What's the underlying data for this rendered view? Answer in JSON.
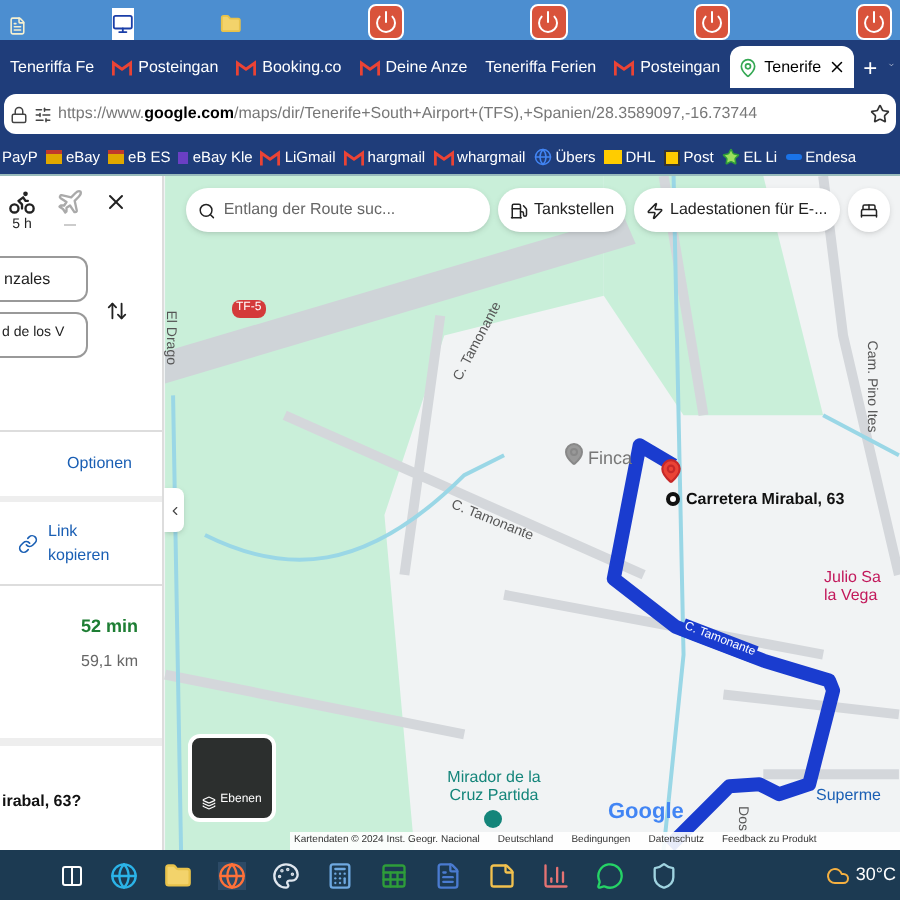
{
  "tabs": [
    {
      "label": "Teneriffa Fe",
      "kind": "plain",
      "selected": false
    },
    {
      "label": "Posteingan",
      "kind": "gmail",
      "selected": false
    },
    {
      "label": "Booking.co",
      "kind": "gmail",
      "selected": false
    },
    {
      "label": "Deine Anze",
      "kind": "gmail",
      "selected": false
    },
    {
      "label": "Teneriffa Ferien",
      "kind": "plain",
      "selected": false
    },
    {
      "label": "Posteingan",
      "kind": "gmail",
      "selected": false
    },
    {
      "label": "Tenerife",
      "kind": "maps",
      "selected": true
    }
  ],
  "new_tab": "+",
  "address_bar": {
    "url": "https://www.**google.com**/maps/dir/Tenerife+South+Airport+(TFS),+Spanien/28.3589097,-16.73744"
  },
  "bookmarks": [
    {
      "label": "PayP",
      "kind": "plain"
    },
    {
      "label": "eBay",
      "kind": "shop"
    },
    {
      "label": "eB ES",
      "kind": "shop"
    },
    {
      "label": "eBay Kle",
      "kind": "ebay"
    },
    {
      "label": "LiGmail",
      "kind": "gmail"
    },
    {
      "label": "hargmail",
      "kind": "gmail"
    },
    {
      "label": "whargmail",
      "kind": "gmail"
    },
    {
      "label": "Übers",
      "kind": "google"
    },
    {
      "label": "DHL",
      "kind": "dhl"
    },
    {
      "label": "Post",
      "kind": "post"
    },
    {
      "label": "EL Li",
      "kind": "star"
    },
    {
      "label": "Endesa",
      "kind": "endesa"
    }
  ],
  "directions": {
    "modes": [
      {
        "kind": "bike",
        "time": "5 h",
        "disabled": false
      },
      {
        "kind": "plane",
        "disabled": true
      }
    ],
    "from": "nzales",
    "to": "d de los V",
    "options_link": "Optionen",
    "share_link": "Link kopieren",
    "route": {
      "duration": "52 min",
      "distance": "59,1 km"
    },
    "question": "irabal, 63?"
  },
  "map": {
    "search_placeholder": "Entlang der Route suc...",
    "chips": [
      {
        "kind": "fuel",
        "label": "Tankstellen"
      },
      {
        "kind": "charger",
        "label": "Ladestationen für E-..."
      },
      {
        "kind": "hotel"
      }
    ],
    "labels": [
      {
        "text": "El Drago",
        "kind": "road"
      },
      {
        "text": "TF-5",
        "kind": "shield"
      },
      {
        "text": "C. Tamonante",
        "kind": "road"
      },
      {
        "text": "Cam. Pino Ites",
        "kind": "road"
      },
      {
        "text": "Finca",
        "kind": "poi"
      },
      {
        "text": "C. Tamonante",
        "kind": "road"
      },
      {
        "text": "C. Tamonante",
        "kind": "route"
      },
      {
        "text": "Julio Sa",
        "kind": "place"
      },
      {
        "text": "la Vega",
        "kind": "place"
      },
      {
        "text": "Mirador de la Cruz Partida",
        "kind": "park"
      },
      {
        "text": "Superme",
        "kind": "shop"
      },
      {
        "text": "Dos",
        "kind": "road"
      }
    ],
    "destination": "Carretera Mirabal, 63",
    "layers_button": "Ebenen",
    "logo": "Google",
    "footer": [
      "Kartendaten © 2024 Inst. Geogr. Nacional",
      "Deutschland",
      "Bedingungen",
      "Datenschutz",
      "Feedback zu Produkt"
    ]
  },
  "taskbar": {
    "temperature": "30°C"
  }
}
